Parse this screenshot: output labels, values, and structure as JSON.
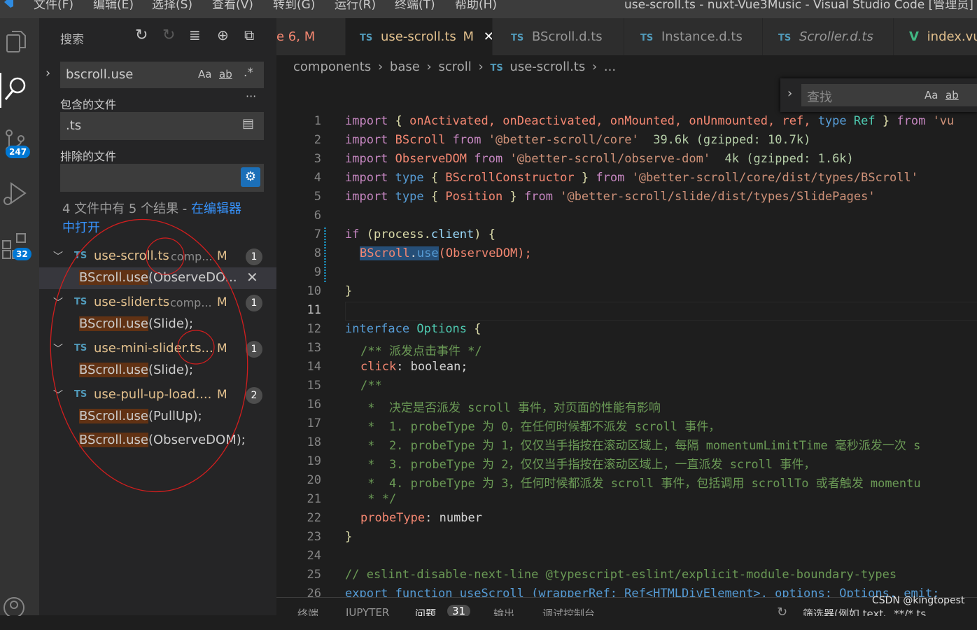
{
  "menu": [
    "文件(F)",
    "编辑(E)",
    "选择(S)",
    "查看(V)",
    "转到(G)",
    "运行(R)",
    "终端(T)",
    "帮助(H)"
  ],
  "window_title": "use-scroll.ts - nuxt-Vue3Music - Visual Studio Code [管理员]",
  "activity": {
    "scm_badge": "247",
    "ext_badge": "32"
  },
  "sidebar": {
    "title": "搜索",
    "search_value": "bscroll.use",
    "opt_case": "Aa",
    "opt_word": "ab",
    "opt_regex": ".*",
    "more": "···",
    "include_label": "包含的文件",
    "include_value": ".ts",
    "exclude_label": "排除的文件",
    "exclude_value": "",
    "summary": "4 文件中有 5 个结果 - ",
    "open_link_1": "在编辑器",
    "open_link_2": "中打开",
    "results": [
      {
        "file": "use-scroll.ts",
        "dir": "comp...",
        "flag": "M",
        "count": "1",
        "matches": [
          {
            "pre": "",
            "match": "BScroll.use",
            "post": "(ObserveDO..."
          }
        ]
      },
      {
        "file": "use-slider.ts",
        "dir": "comp...",
        "flag": "M",
        "count": "1",
        "matches": [
          {
            "pre": "",
            "match": "BScroll.use",
            "post": "(Slide);"
          }
        ]
      },
      {
        "file": "use-mini-slider.ts...",
        "dir": "",
        "flag": "M",
        "count": "1",
        "matches": [
          {
            "pre": "",
            "match": "BScroll.use",
            "post": "(Slide);"
          }
        ]
      },
      {
        "file": "use-pull-up-load....",
        "dir": "",
        "flag": "M",
        "count": "2",
        "matches": [
          {
            "pre": "",
            "match": "BScroll.use",
            "post": "(PullUp);"
          },
          {
            "pre": "",
            "match": "BScroll.use",
            "post": "(ObserveDOM);"
          }
        ]
      }
    ]
  },
  "tabs": [
    {
      "label": "e 6, M",
      "icon": "",
      "color": "#f48771"
    },
    {
      "label": "use-scroll.ts",
      "icon": "TS",
      "flag": "M",
      "active": true
    },
    {
      "label": "BScroll.d.ts",
      "icon": "TS"
    },
    {
      "label": "Instance.d.ts",
      "icon": "TS"
    },
    {
      "label": "Scroller.d.ts",
      "icon": "TS"
    },
    {
      "label": "index.vu",
      "icon": "V"
    }
  ],
  "breadcrumb": [
    "components",
    "base",
    "scroll",
    "use-scroll.ts",
    "..."
  ],
  "find": {
    "placeholder": "查找",
    "opt_case": "Aa",
    "opt_word": "ab"
  },
  "code_lines": [
    "1",
    "2",
    "3",
    "4",
    "5",
    "6",
    "7",
    "8",
    "9",
    "10",
    "11",
    "12",
    "13",
    "14",
    "15",
    "16",
    "17",
    "18",
    "19",
    "20",
    "21",
    "22",
    "23",
    "24",
    "25",
    "26"
  ],
  "code": {
    "l1": [
      "import",
      "{",
      "onActivated,",
      "onDeactivated,",
      "onMounted,",
      "onUnmounted,",
      "ref,",
      "type",
      "Ref",
      "}",
      "from",
      "'vu"
    ],
    "l2": [
      "import",
      "BScroll",
      "from",
      "'@better-scroll/core'",
      "39.6k (gzipped: 10.7k)"
    ],
    "l3": [
      "import",
      "ObserveDOM",
      "from",
      "'@better-scroll/observe-dom'",
      "4k (gzipped: 1.6k)"
    ],
    "l4": [
      "import",
      "type",
      "{",
      "BScrollConstructor",
      "}",
      "from",
      "'@better-scroll/core/dist/types/BScroll'"
    ],
    "l5": [
      "import",
      "type",
      "{",
      "Position",
      "}",
      "from",
      "'@better-scroll/slide/dist/types/SlidePages'"
    ],
    "l7": [
      "if",
      "(process.",
      "client",
      ")",
      "{"
    ],
    "l8": [
      "BScroll",
      ".",
      "use",
      "(ObserveDOM);"
    ],
    "l10": "}",
    "l12": [
      "interface",
      "Options",
      "{"
    ],
    "l13": "/** 派发点击事件 */",
    "l14": [
      "click",
      ": boolean;"
    ],
    "l15": "/**",
    "l16": " *  决定是否派发 scroll 事件，对页面的性能有影响",
    "l17": " *  1. probeType 为 0，在任何时候都不派发 scroll 事件，",
    "l18": " *  2. probeType 为 1，仅仅当手指按在滚动区域上，每隔 momentumLimitTime 毫秒派发一次 s",
    "l19": " *  3. probeType 为 2，仅仅当手指按在滚动区域上，一直派发 scroll 事件，",
    "l20": " *  4. probeType 为 3，任何时候都派发 scroll 事件，包括调用 scrollTo 或者触发 momentu",
    "l21": " * */",
    "l22": [
      "probeType",
      ": number"
    ],
    "l23": "}",
    "l25": "// eslint-disable-next-line @typescript-eslint/explicit-module-boundary-types",
    "l26": "export function useScroll (wrapperRef: Ref<HTMLDivElement>, options: Options, emit:"
  },
  "panel": {
    "tabs": [
      "终端",
      "JUPYTER",
      "问题",
      "输出",
      "调试控制台"
    ],
    "problems_count": "31",
    "filter": "筛选器(例如 text、**/*.ts"
  },
  "watermark": "CSDN @kingtopest",
  "colors": {
    "accent": "#0078d4",
    "match_bg": "#613214",
    "annotation": "#d21e1e"
  }
}
